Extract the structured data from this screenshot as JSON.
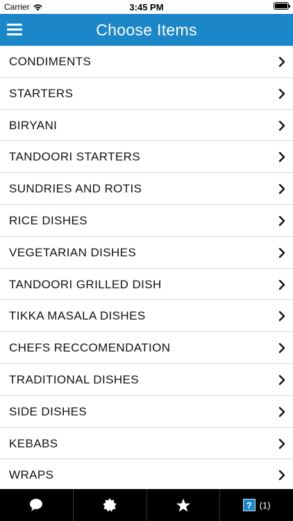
{
  "status_bar": {
    "carrier": "Carrier",
    "time": "3:45 PM"
  },
  "header": {
    "title": "Choose Items"
  },
  "menu": {
    "items": [
      {
        "label": "CONDIMENTS"
      },
      {
        "label": "STARTERS"
      },
      {
        "label": "BIRYANI"
      },
      {
        "label": "TANDOORI STARTERS"
      },
      {
        "label": "SUNDRIES AND ROTIS"
      },
      {
        "label": "RICE DISHES"
      },
      {
        "label": "VEGETARIAN DISHES"
      },
      {
        "label": "TANDOORI GRILLED DISH"
      },
      {
        "label": "TIKKA MASALA DISHES"
      },
      {
        "label": "CHEFS RECCOMENDATION"
      },
      {
        "label": "TRADITIONAL DISHES"
      },
      {
        "label": "SIDE DISHES"
      },
      {
        "label": "KEBABS"
      },
      {
        "label": "WRAPS"
      }
    ]
  },
  "tab_bar": {
    "tabs": [
      {
        "icon": "speech-bubble-icon"
      },
      {
        "icon": "badge-star-icon"
      },
      {
        "icon": "star-icon"
      },
      {
        "icon": "cart-icon",
        "glyph": "?",
        "count": "(1)"
      }
    ]
  },
  "colors": {
    "header_bg": "#1b87c9",
    "tab_bar_bg": "#000000",
    "divider": "#d7d7d7"
  }
}
